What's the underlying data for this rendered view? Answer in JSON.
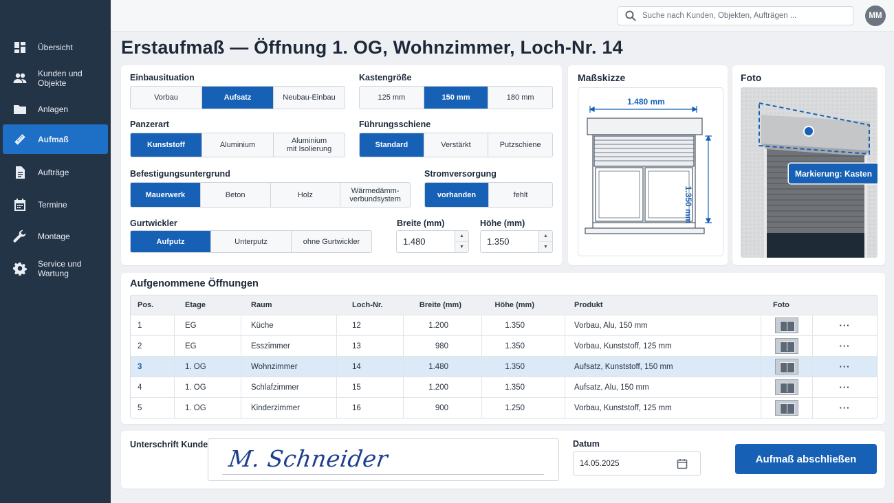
{
  "nav": {
    "items": [
      {
        "label": "Übersicht",
        "icon": "dashboard-icon"
      },
      {
        "label": "Kunden und Objekte",
        "icon": "people-icon"
      },
      {
        "label": "Anlagen",
        "icon": "folder-icon"
      },
      {
        "label": "Aufmaß",
        "icon": "ruler-icon"
      },
      {
        "label": "Aufträge",
        "icon": "document-icon"
      },
      {
        "label": "Termine",
        "icon": "calendar-icon"
      },
      {
        "label": "Montage",
        "icon": "wrench-icon"
      },
      {
        "label": "Service und Wartung",
        "icon": "gear-icon"
      }
    ],
    "active": "Aufmaß"
  },
  "topbar": {
    "search_placeholder": "Suche nach Kunden, Objekten, Aufträgen ...",
    "avatar_initials": "MM"
  },
  "page_title": "Erstaufmaß — Öffnung 1. OG, Wohnzimmer, Loch-Nr. 14",
  "form": {
    "einbausituation": {
      "label": "Einbausituation",
      "options": [
        "Vorbau",
        "Aufsatz",
        "Neubau-Einbau"
      ],
      "selected": "Aufsatz"
    },
    "kastengroesse": {
      "label": "Kastengröße",
      "options": [
        "125 mm",
        "150 mm",
        "180 mm"
      ],
      "selected": "150 mm"
    },
    "panzerart": {
      "label": "Panzerart",
      "options": [
        "Kunststoff",
        "Aluminium",
        "Aluminium\nmit Isolierung"
      ],
      "selected": "Kunststoff"
    },
    "fuehrungsschiene": {
      "label": "Führungsschiene",
      "options": [
        "Standard",
        "Verstärkt",
        "Putzschiene"
      ],
      "selected": "Standard"
    },
    "befestigung": {
      "label": "Befestigungsuntergrund",
      "options": [
        "Mauerwerk",
        "Beton",
        "Holz",
        "Wärmedämm-\nverbundsystem"
      ],
      "selected": "Mauerwerk"
    },
    "strom": {
      "label": "Stromversorgung",
      "options": [
        "vorhanden",
        "fehlt"
      ],
      "selected": "vorhanden"
    },
    "gurtwickler": {
      "label": "Gurtwickler",
      "options": [
        "Aufputz",
        "Unterputz",
        "ohne Gurtwickler"
      ],
      "selected": "Aufputz"
    },
    "breite": {
      "label": "Breite (mm)",
      "value": "1.480"
    },
    "hoehe": {
      "label": "Höhe (mm)",
      "value": "1.350"
    }
  },
  "sketch": {
    "title": "Maßskizze",
    "width_label": "1.480 mm",
    "height_label": "1.350 mm"
  },
  "photo": {
    "title": "Foto",
    "marker_label": "Markierung: Kasten"
  },
  "openings": {
    "title": "Aufgenommene Öffnungen",
    "columns": [
      "Pos.",
      "Etage",
      "Raum",
      "Loch-Nr.",
      "Breite (mm)",
      "Höhe (mm)",
      "Produkt",
      "Foto"
    ],
    "rows": [
      {
        "pos": "1",
        "etage": "EG",
        "raum": "Küche",
        "loch": "12",
        "breite": "1.200",
        "hoehe": "1.350",
        "produkt": "Vorbau, Alu, 150 mm"
      },
      {
        "pos": "2",
        "etage": "EG",
        "raum": "Esszimmer",
        "loch": "13",
        "breite": "980",
        "hoehe": "1.350",
        "produkt": "Vorbau, Kunststoff, 125 mm"
      },
      {
        "pos": "3",
        "etage": "1. OG",
        "raum": "Wohnzimmer",
        "loch": "14",
        "breite": "1.480",
        "hoehe": "1.350",
        "produkt": "Aufsatz, Kunststoff, 150 mm"
      },
      {
        "pos": "4",
        "etage": "1. OG",
        "raum": "Schlafzimmer",
        "loch": "15",
        "breite": "1.200",
        "hoehe": "1.350",
        "produkt": "Aufsatz, Alu, 150 mm"
      },
      {
        "pos": "5",
        "etage": "1. OG",
        "raum": "Kinderzimmer",
        "loch": "16",
        "breite": "900",
        "hoehe": "1.250",
        "produkt": "Vorbau, Kunststoff, 125 mm"
      }
    ],
    "highlighted_pos": "3",
    "row_menu_glyph": "···"
  },
  "signature": {
    "label": "Unterschrift Kunde",
    "signature_text": "M. Schneider"
  },
  "date": {
    "label": "Datum",
    "value": "14.05.2025"
  },
  "finish_button": "Aufmaß abschließen",
  "colors": {
    "sidebar": "#243447",
    "accent": "#1660b5",
    "highlight_row": "#dce9f7"
  }
}
